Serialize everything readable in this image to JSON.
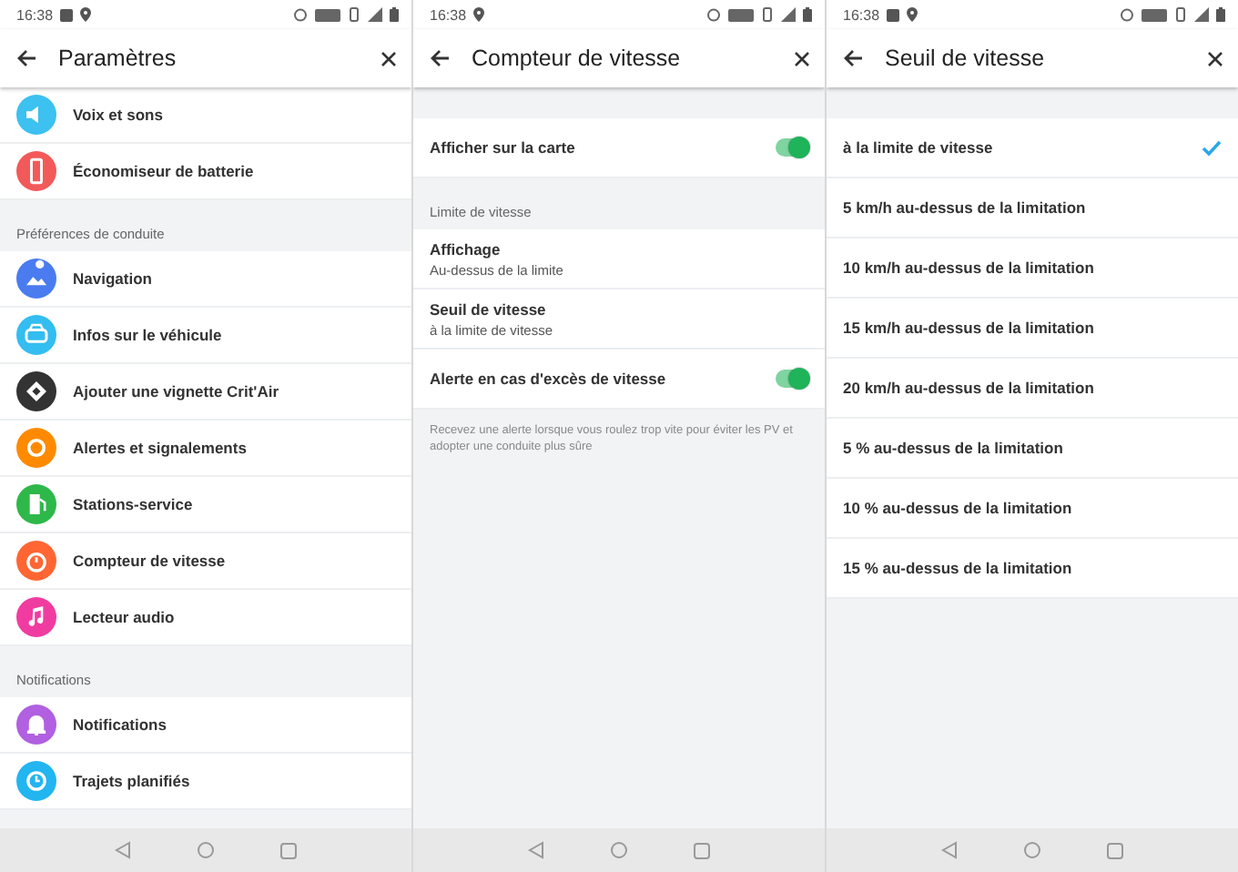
{
  "screens": [
    {
      "kind": "menu",
      "status_bar": {
        "time": "16:38",
        "photo_notification": true
      },
      "title": "Paramètres",
      "sections": [
        {
          "items": [
            {
              "label": "Voix et sons",
              "color": "#3cc1f0"
            },
            {
              "label": "Économiseur de batterie",
              "color": "#f25a5a"
            }
          ]
        },
        {
          "header": "Préférences de conduite",
          "items": [
            {
              "label": "Navigation",
              "color": "#4a7cf0"
            },
            {
              "label": "Infos sur le véhicule",
              "color": "#33bdf0"
            },
            {
              "label": "Ajouter une vignette Crit'Air",
              "color": "#333333"
            },
            {
              "label": "Alertes et signalements",
              "color": "#ff8a00"
            },
            {
              "label": "Stations-service",
              "color": "#2eb84a"
            },
            {
              "label": "Compteur de vitesse",
              "color": "#ff6633"
            },
            {
              "label": "Lecteur audio",
              "color": "#f03ca0"
            }
          ]
        },
        {
          "header": "Notifications",
          "items": [
            {
              "label": "Notifications",
              "color": "#b060e0"
            },
            {
              "label": "Trajets planifiés",
              "color": "#22b5f0"
            }
          ]
        }
      ]
    },
    {
      "kind": "settings",
      "status_bar": {
        "time": "16:38",
        "photo_notification": false
      },
      "title": "Compteur de vitesse",
      "sections": [
        {
          "items": [
            {
              "kind": "toggle",
              "label": "Afficher sur la carte",
              "on": true
            }
          ]
        },
        {
          "header": "Limite de vitesse",
          "items": [
            {
              "kind": "link",
              "label": "Affichage",
              "subtitle": "Au-dessus de la limite"
            },
            {
              "kind": "link",
              "label": "Seuil de vitesse",
              "subtitle": "à la limite de vitesse"
            },
            {
              "kind": "toggle",
              "label": "Alerte en cas d'excès de vitesse",
              "on": true
            }
          ],
          "footnote": "Recevez une alerte lorsque vous roulez trop vite pour éviter les PV et adopter une conduite plus sûre"
        }
      ]
    },
    {
      "kind": "choices",
      "status_bar": {
        "time": "16:38",
        "photo_notification": true
      },
      "title": "Seuil de vitesse",
      "options": [
        {
          "label": "à la limite de vitesse",
          "selected": true
        },
        {
          "label": "5 km/h au-dessus de la limitation",
          "selected": false
        },
        {
          "label": "10 km/h au-dessus de la limitation",
          "selected": false
        },
        {
          "label": "15 km/h au-dessus de la limitation",
          "selected": false
        },
        {
          "label": "20 km/h au-dessus de la limitation",
          "selected": false
        },
        {
          "label": "5 % au-dessus de la limitation",
          "selected": false
        },
        {
          "label": "10 % au-dessus de la limitation",
          "selected": false
        },
        {
          "label": "15 % au-dessus de la limitation",
          "selected": false
        }
      ]
    }
  ]
}
